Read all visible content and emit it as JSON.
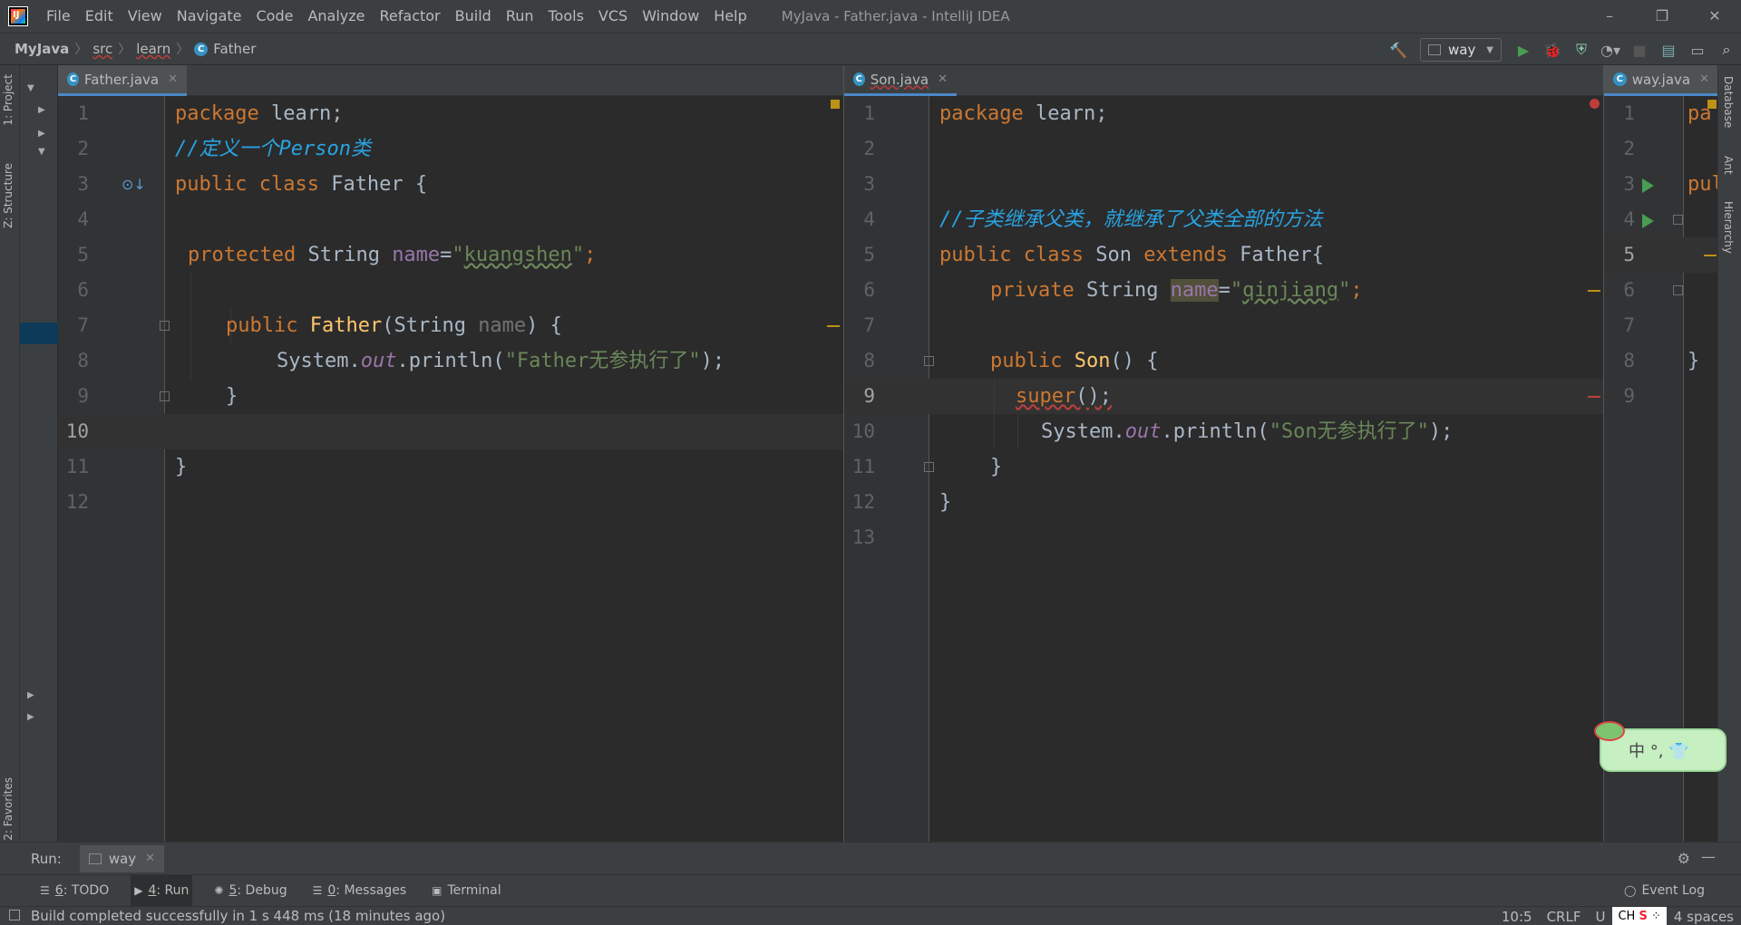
{
  "title_bar": {
    "menus": [
      "File",
      "Edit",
      "View",
      "Navigate",
      "Code",
      "Analyze",
      "Refactor",
      "Build",
      "Run",
      "Tools",
      "VCS",
      "Window",
      "Help"
    ],
    "window_title": "MyJava - Father.java - IntelliJ IDEA",
    "controls": [
      "–",
      "❐",
      "✕"
    ]
  },
  "navbar": {
    "project": "MyJava",
    "crumbs": [
      "src",
      "learn"
    ],
    "class_name": "Father",
    "run_config": "way"
  },
  "left_strip": {
    "project_tab": "1: Project",
    "structure_tab": "Z: Structure",
    "favorites_tab": "2: Favorites"
  },
  "right_strip": {
    "tabs": [
      "Database",
      "Ant",
      "Hierarchy"
    ]
  },
  "pane_left": {
    "tab": "Father.java",
    "lines": [
      "1",
      "2",
      "3",
      "4",
      "5",
      "6",
      "7",
      "8",
      "9",
      "10",
      "11",
      "12"
    ],
    "current_line": "10",
    "code": {
      "l1_kw": "package",
      "l1_rest": " learn;",
      "l2_comment": "//定义一个Person类",
      "l3_kw": "public class",
      "l3_rest": " Father {",
      "l5_kw": "protected",
      "l5_type": " String ",
      "l5_field": "name",
      "l5_eq": "=",
      "l5_str_q1": "\"",
      "l5_str": "kuangshen",
      "l5_str_q2": "\"",
      "l5_semi": ";",
      "l7_kw": "public",
      "l7_fn": "Father",
      "l7_p1": "(String ",
      "l7_param": "name",
      "l7_p2": ") {",
      "l8_a": "System.",
      "l8_out": "out",
      "l8_b": ".println(",
      "l8_str": "\"Father无参执行了\"",
      "l8_c": ");",
      "l9": "}",
      "l11": "}"
    }
  },
  "pane_mid": {
    "tab": "Son.java",
    "lines": [
      "1",
      "2",
      "3",
      "4",
      "5",
      "6",
      "7",
      "8",
      "9",
      "10",
      "11",
      "12",
      "13"
    ],
    "current_line": "9",
    "code": {
      "l1_kw": "package",
      "l1_rest": " learn;",
      "l4_comment": "//子类继承父类，就继承了父类全部的方法",
      "l5_kw1": "public class",
      "l5_name": " Son ",
      "l5_kw2": "extends",
      "l5_rest": " Father{",
      "l6_kw": "private",
      "l6_type": " String ",
      "l6_field": "name",
      "l6_eq": "=",
      "l6_q1": "\"",
      "l6_str": "qinjiang",
      "l6_q2": "\"",
      "l6_semi": ";",
      "l8_kw": "public",
      "l8_fn": "Son",
      "l8_rest": "() {",
      "l9_kw": "super",
      "l9_rest": "();",
      "l10_a": "System.",
      "l10_out": "out",
      "l10_b": ".println(",
      "l10_str": "\"Son无参执行了\"",
      "l10_c": ");",
      "l11": "}",
      "l12": "}"
    }
  },
  "pane_right": {
    "tab": "way.java",
    "lines": [
      "1",
      "2",
      "3",
      "4",
      "5",
      "6",
      "7",
      "8",
      "9"
    ],
    "current_line": "5",
    "code": {
      "l1": "pa",
      "l3": "pul",
      "l8": "}"
    }
  },
  "run_bar": {
    "label": "Run:",
    "tab": "way"
  },
  "bottom_tabs": [
    {
      "key": "6",
      "label": ": TODO"
    },
    {
      "key": "4",
      "label": ": Run"
    },
    {
      "key": "5",
      "label": ": Debug"
    },
    {
      "key": "0",
      "label": ": Messages"
    },
    {
      "key": "",
      "label": "Terminal"
    }
  ],
  "event_log": "Event Log",
  "status": {
    "message": "Build completed successfully in 1 s 448 ms (18 minutes ago)",
    "position": "10:5",
    "line_sep": "CRLF",
    "encoding": "U",
    "indent": "4 spaces"
  },
  "ime": {
    "label": "中 °, 👕"
  },
  "colors": {
    "keyword": "#cc7832",
    "string": "#6a8759",
    "comment": "#29a3e2",
    "field": "#9876aa",
    "function": "#ffc66d",
    "run": "#499c54"
  }
}
